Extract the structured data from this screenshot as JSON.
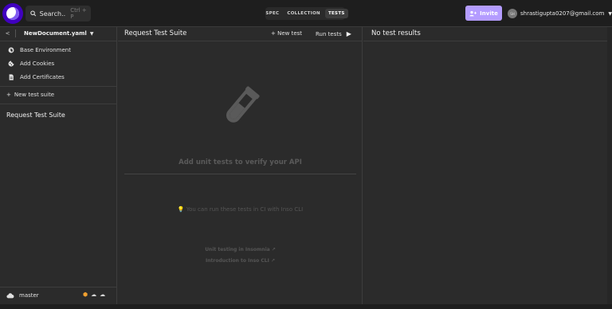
{
  "topbar": {
    "search_label": "Search..",
    "search_shortcut": "Ctrl + P",
    "modes": [
      "SPEC",
      "COLLECTION",
      "TESTS"
    ],
    "active_mode": "TESTS",
    "invite_label": "Invite",
    "avatar_initials": "SH",
    "account_email": "shrastigupta0207@gmail.com"
  },
  "sidebar": {
    "document_name": "NewDocument.yaml",
    "items": [
      {
        "label": "Base Environment",
        "icon": "globe-icon"
      },
      {
        "label": "Add Cookies",
        "icon": "cookie-icon"
      },
      {
        "label": "Add Certificates",
        "icon": "certificate-icon"
      }
    ],
    "new_suite_label": "New test suite",
    "suites": [
      "Request Test Suite"
    ],
    "branch": "master"
  },
  "center": {
    "title": "Request Test Suite",
    "new_test_label": "New test",
    "run_tests_label": "Run tests",
    "empty_message": "Add unit tests to verify your API",
    "cli_tip": "You can run these tests in CI with Inso CLI",
    "links": [
      "Unit testing in Insomnia",
      "Introduction to Inso CLI"
    ]
  },
  "results": {
    "title": "No test results"
  },
  "colors": {
    "brand": "#4000bf",
    "invite": "#b49cff",
    "background": "#2b2b2b",
    "topbar": "#1e1e1e"
  }
}
